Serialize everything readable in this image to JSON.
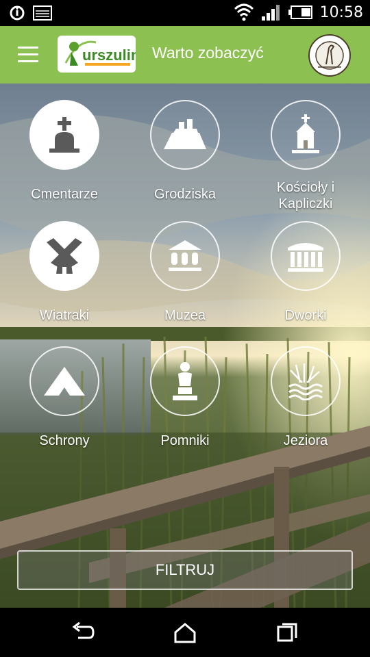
{
  "status_bar": {
    "time": "10:58"
  },
  "app_bar": {
    "title": "Warto zobaczyć",
    "logo_text": "Turszulin",
    "emblem_text": "POLESKI PARK NARODOWY"
  },
  "categories": [
    {
      "label": "Cmentarze",
      "icon": "tombstone-icon",
      "active": true
    },
    {
      "label": "Grodziska",
      "icon": "fortress-icon",
      "active": false
    },
    {
      "label": "Kościoły i\nKapliczki",
      "icon": "church-icon",
      "active": false
    },
    {
      "label": "Wiatraki",
      "icon": "windmill-icon",
      "active": true
    },
    {
      "label": "Muzea",
      "icon": "museum-icon",
      "active": false
    },
    {
      "label": "Dworki",
      "icon": "manor-icon",
      "active": false
    },
    {
      "label": "Schrony",
      "icon": "shelter-icon",
      "active": false
    },
    {
      "label": "Pomniki",
      "icon": "monument-icon",
      "active": false
    },
    {
      "label": "Jeziora",
      "icon": "lake-icon",
      "active": false
    }
  ],
  "filter_button": {
    "label": "FILTRUJ"
  },
  "colors": {
    "app_bar": "#8cc152",
    "icon_dark": "#5a5a5a",
    "white": "#ffffff"
  }
}
